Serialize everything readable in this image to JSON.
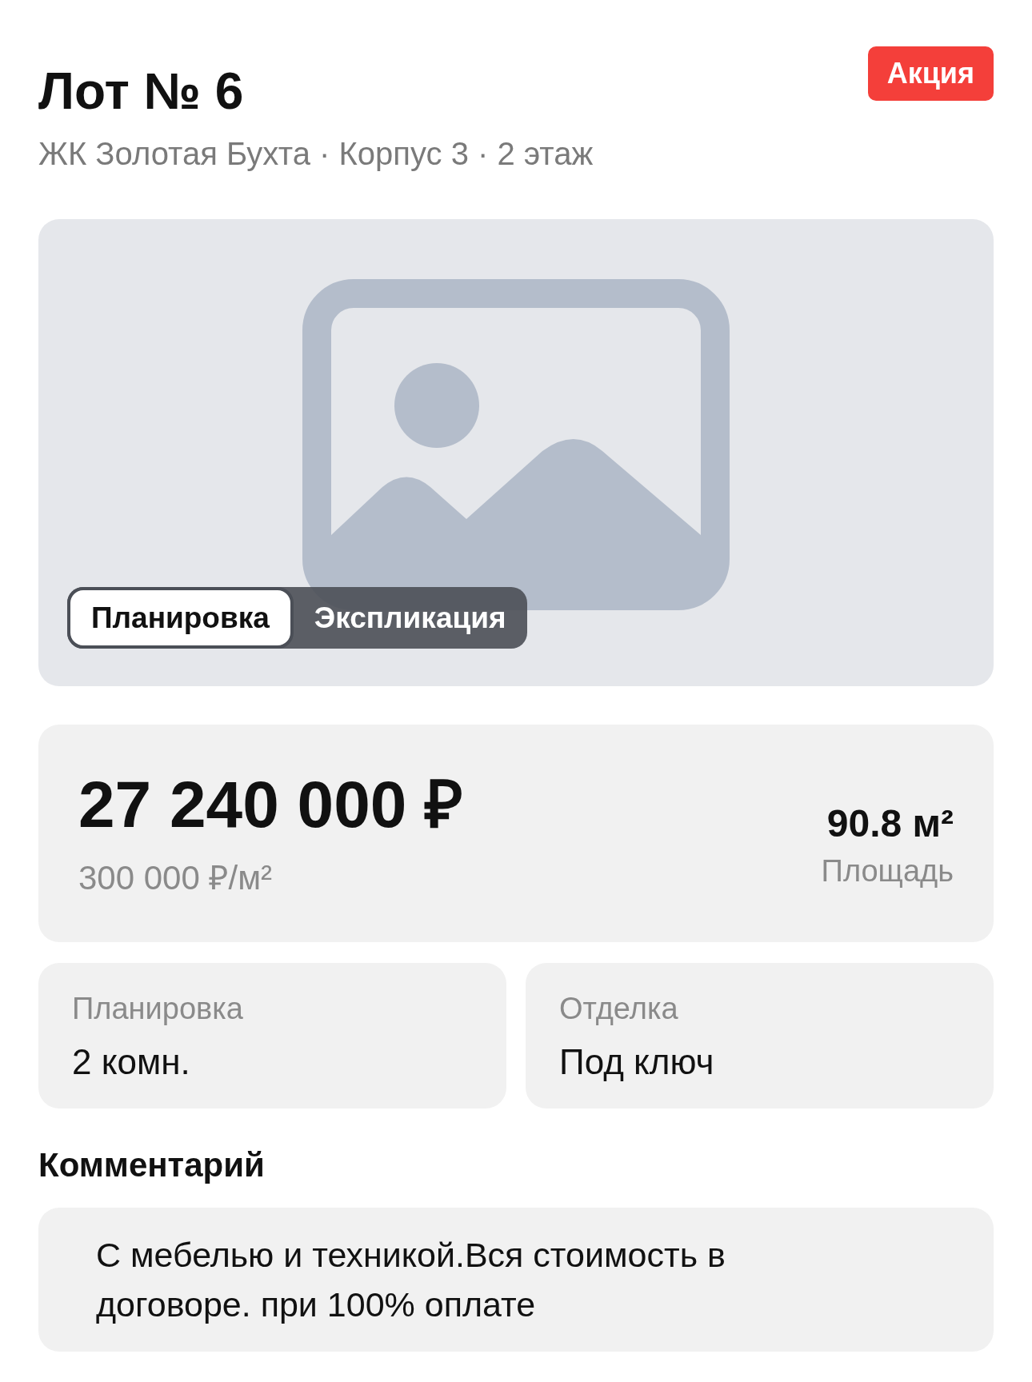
{
  "header": {
    "title": "Лот № 6",
    "badge": "Акция",
    "subtitle": "ЖК Золотая Бухта · Корпус 3 · 2 этаж"
  },
  "media": {
    "tabs": [
      {
        "label": "Планировка",
        "selected": true
      },
      {
        "label": "Экспликация",
        "selected": false
      }
    ]
  },
  "price": {
    "total": "27 240 000 ₽",
    "per_meter": "300 000 ₽/м²",
    "area": "90.8 м²",
    "area_label": "Площадь"
  },
  "features": [
    {
      "label": "Планировка",
      "value": "2 комн."
    },
    {
      "label": "Отделка",
      "value": "Под ключ"
    }
  ],
  "comment": {
    "heading": "Комментарий",
    "text": "С мебелью и техникой.Вся стоимость в договоре. при 100% оплате"
  }
}
